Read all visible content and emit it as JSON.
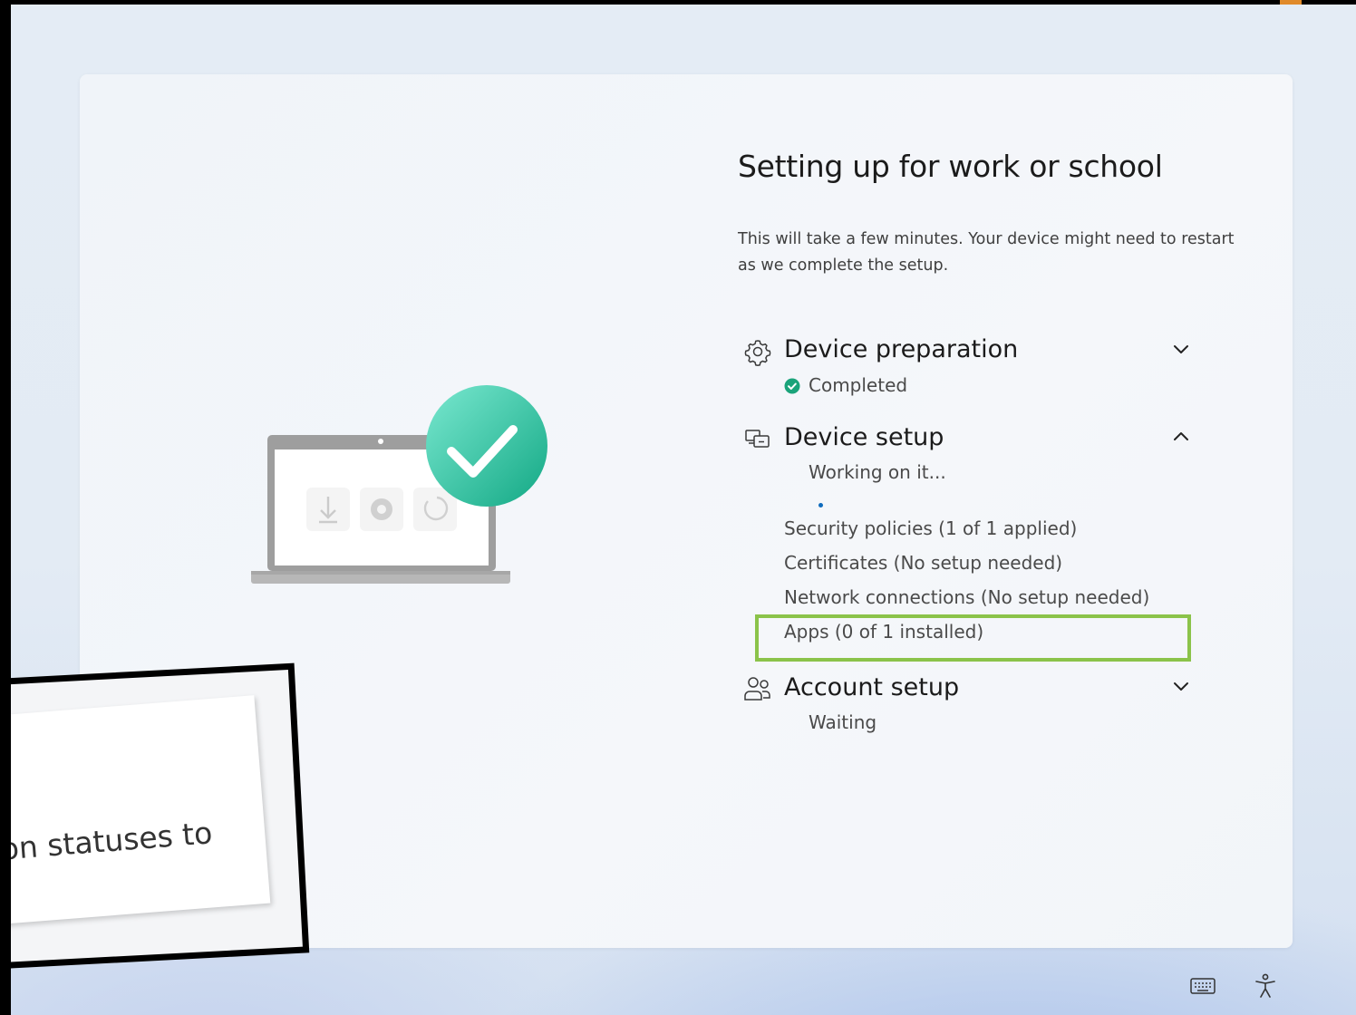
{
  "title": "Setting up for work or school",
  "subtitle": "This will take a few minutes. Your device might need to restart as we complete the setup.",
  "sections": {
    "device_preparation": {
      "title": "Device preparation",
      "status": "Completed",
      "icon": "gear-icon",
      "expanded": false
    },
    "device_setup": {
      "title": "Device setup",
      "status": "Working on it...",
      "icon": "device-setup-icon",
      "expanded": true,
      "items": [
        "Security policies (1 of 1 applied)",
        "Certificates (No setup needed)",
        "Network connections (No setup needed)",
        "Apps (0 of 1 installed)"
      ]
    },
    "account_setup": {
      "title": "Account setup",
      "status": "Waiting",
      "icon": "people-icon",
      "expanded": false
    }
  },
  "callout": {
    "text": "on statuses to"
  },
  "colors": {
    "accent_blue": "#0f6cbd",
    "success_green": "#1aa37a",
    "highlight_green": "#8bc34a",
    "check_teal": "#2ec4a0"
  },
  "tray": {
    "icons": [
      "keyboard-icon",
      "accessibility-icon"
    ]
  }
}
